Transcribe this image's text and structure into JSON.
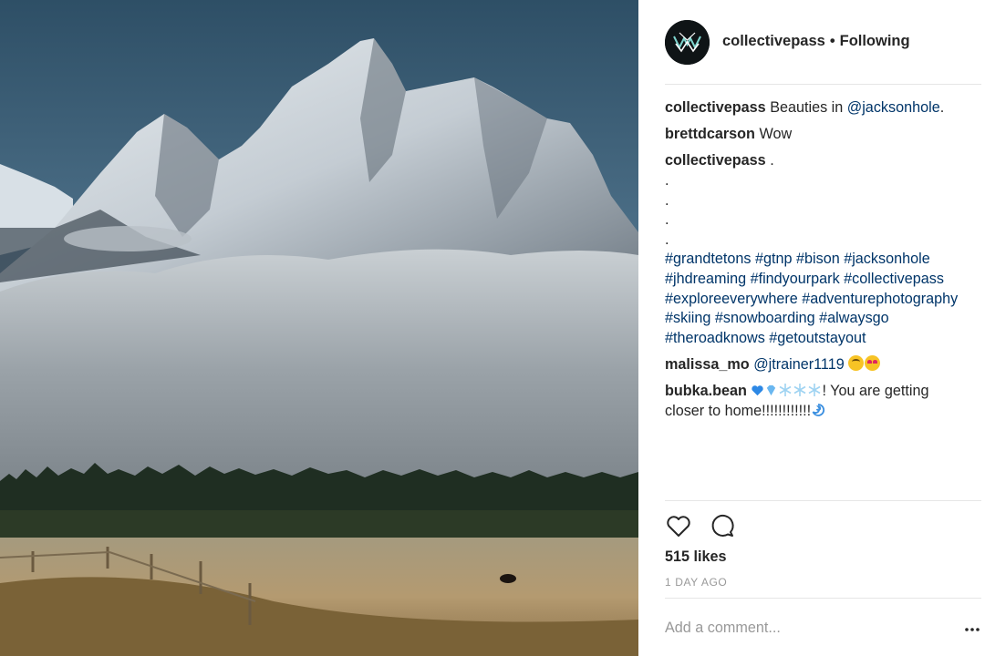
{
  "post": {
    "username": "collectivepass",
    "separator": "•",
    "follow_status": "Following",
    "likes_label": "515 likes",
    "time_ago": "1 DAY AGO",
    "add_comment_placeholder": "Add a comment...",
    "icons": [
      "avatar-logo",
      "heart-icon",
      "comment-icon",
      "more-options-icon"
    ]
  },
  "comments": {
    "c1": {
      "user": "collectivepass",
      "text": "Beauties in ",
      "mention": "@jacksonhole",
      "after": "."
    },
    "c2": {
      "user": "brettdcarson",
      "text": "Wow"
    },
    "c3": {
      "user": "collectivepass",
      "text": ".",
      "dots": [
        ".",
        ".",
        ".",
        "."
      ],
      "tag_lines": [
        "#grandtetons #gtnp #bison #jacksonhole",
        "#jhdreaming #findyourpark #collectivepass",
        "#exploreeverywhere #adventurephotography",
        "#skiing #snowboarding #alwaysgo",
        "#theroadknows #getoutstayout"
      ]
    },
    "c4": {
      "user": "malissa_mo",
      "mention": "@jtrainer1119"
    },
    "c5": {
      "user": "bubka.bean",
      "text": "! You are getting",
      "text2": "closer to home!!!!!!!!!!!!"
    }
  },
  "colors": {
    "link": "#003569",
    "text": "#262626",
    "muted": "#999999",
    "divider": "#e6e6e6"
  }
}
